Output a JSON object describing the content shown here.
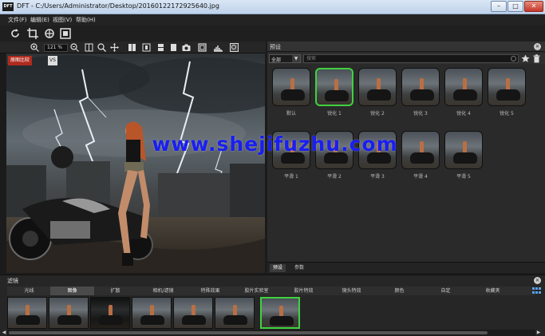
{
  "window": {
    "title": "DFT - C:/Users/Administrator/Desktop/20160122172925640.jpg",
    "app_icon_text": "DFT",
    "min": "–",
    "max": "□",
    "close": "✕"
  },
  "menu": [
    {
      "label": "文件(F)"
    },
    {
      "label": "编辑(E)"
    },
    {
      "label": "视图(V)"
    },
    {
      "label": "帮助(H)"
    }
  ],
  "toolbar2": {
    "zoom": "121 %"
  },
  "preview": {
    "badge": "原图比较",
    "badge2": "VS"
  },
  "presets_panel": {
    "title": "预设",
    "dropdown": "全部",
    "search_placeholder": "搜索",
    "tabs": [
      {
        "label": "预设"
      },
      {
        "label": "参数"
      }
    ],
    "items": [
      {
        "label": "默认",
        "selected": false
      },
      {
        "label": "锐化 1",
        "selected": true
      },
      {
        "label": "锐化 2",
        "selected": false
      },
      {
        "label": "锐化 3",
        "selected": false
      },
      {
        "label": "锐化 4",
        "selected": false
      },
      {
        "label": "锐化 5",
        "selected": false
      },
      {
        "label": "平滑 1",
        "selected": false
      },
      {
        "label": "平滑 2",
        "selected": false
      },
      {
        "label": "平滑 3",
        "selected": false
      },
      {
        "label": "平滑 4",
        "selected": false
      },
      {
        "label": "平滑 5",
        "selected": false
      }
    ]
  },
  "filter_panel": {
    "title": "滤镜",
    "categories": [
      {
        "label": "光线"
      },
      {
        "label": "图像"
      },
      {
        "label": "扩散"
      },
      {
        "label": "相机/滤镜"
      },
      {
        "label": "特殊效果"
      },
      {
        "label": "胶片实验室"
      },
      {
        "label": "胶片特效"
      },
      {
        "label": "镜头特效"
      },
      {
        "label": "颜色"
      },
      {
        "label": "自定"
      },
      {
        "label": "收藏夹"
      }
    ],
    "active_category": "图像"
  },
  "watermark": "www.shejifuzhu.com",
  "colors": {
    "accent_selected": "#3fd23f",
    "watermark": "#1a1ef0"
  }
}
